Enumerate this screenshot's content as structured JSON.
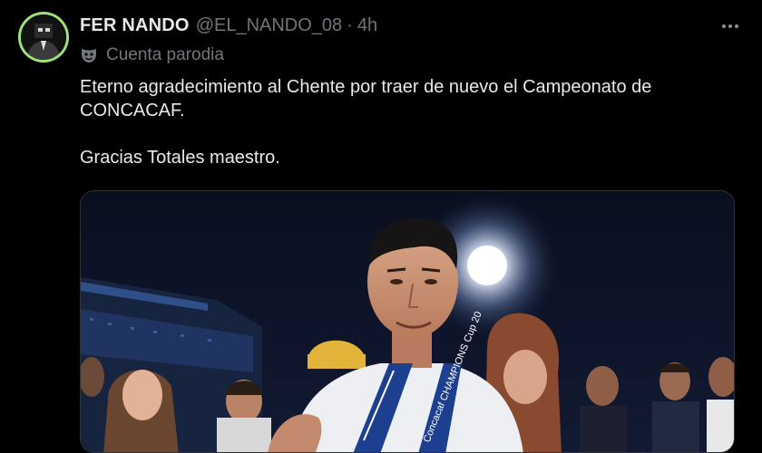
{
  "tweet": {
    "author": {
      "display_name": "FER NANDO",
      "handle": "@EL_NANDO_08",
      "time_ago": "4h",
      "separator": "·",
      "label": "Cuenta parodia",
      "avatar_ring_color": "#9ee37a"
    },
    "text": {
      "line1": "Eterno agradecimiento al Chente por traer de nuevo el Campeonato de",
      "line2": "CONCACAF.",
      "line3": "Gracias Totales maestro."
    },
    "media": {
      "medal_ribbon_text": "Concacaf CHAMPIONS Cup 20"
    },
    "icons": {
      "more": "more-horizontal-icon",
      "label": "parody-mask-icon"
    },
    "colors": {
      "background": "#000000",
      "primary_text": "#e7e9ea",
      "secondary_text": "#71767b",
      "border": "#2f3336"
    }
  }
}
